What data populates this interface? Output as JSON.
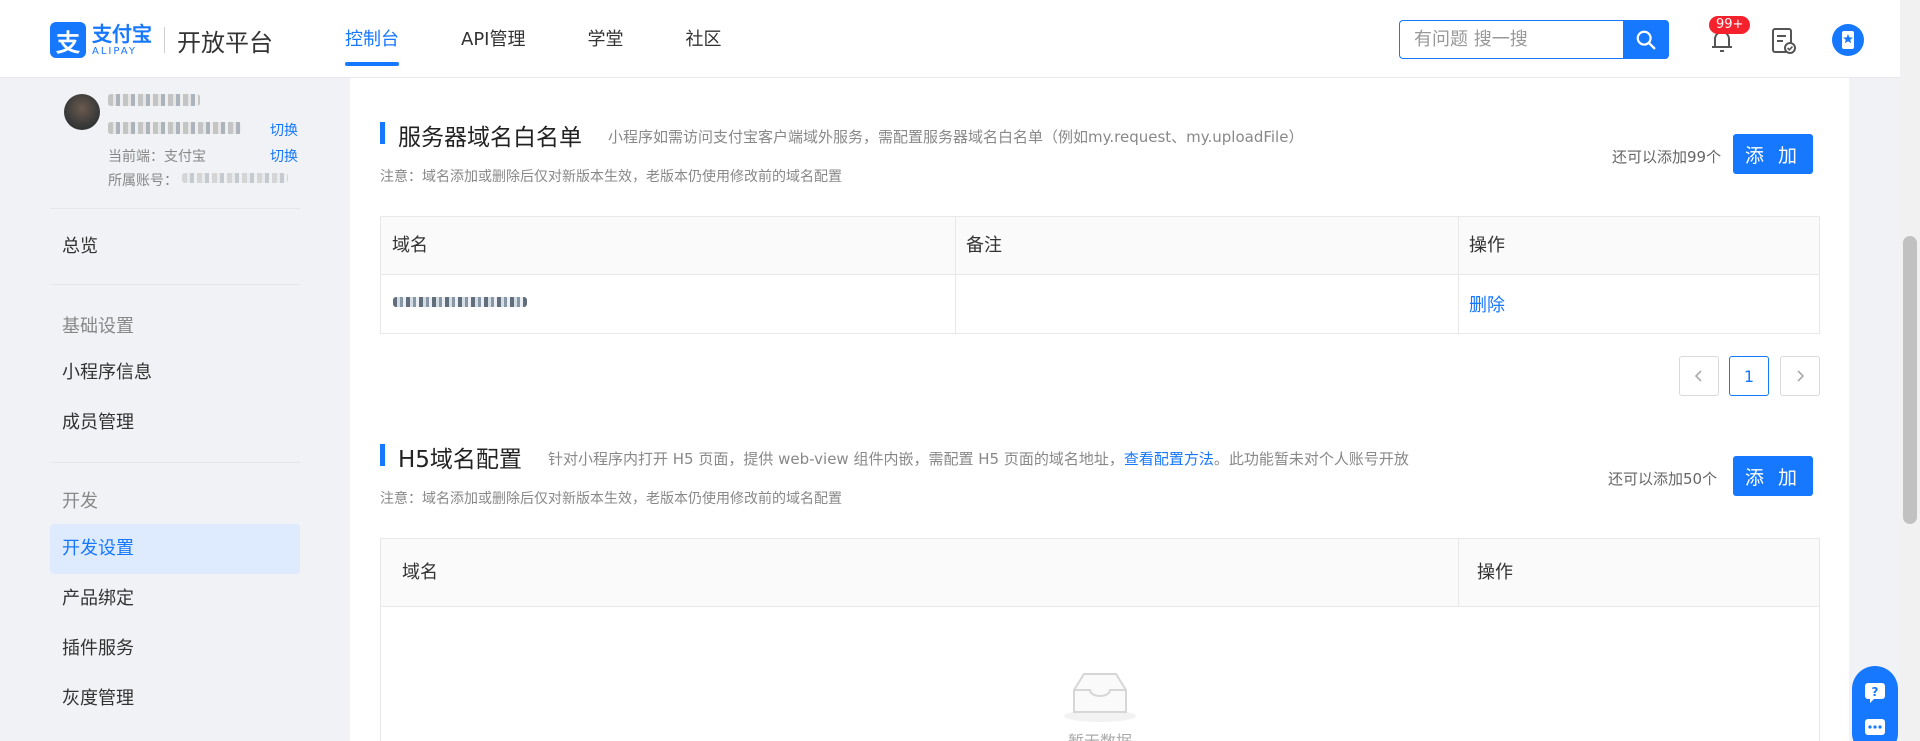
{
  "header": {
    "logo_cn": "支付宝",
    "logo_en": "ALIPAY",
    "platform": "开放平台",
    "nav": [
      "控制台",
      "API管理",
      "学堂",
      "社区"
    ],
    "search_placeholder": "有问题 搜一搜",
    "notification_badge": "99+"
  },
  "sidebar": {
    "switch_label": "切换",
    "current_client_label": "当前端：支付宝",
    "account_label": "所属账号：",
    "overview": "总览",
    "group_basic": "基础设置",
    "miniapp_info": "小程序信息",
    "member_mgmt": "成员管理",
    "group_dev": "开发",
    "dev_settings": "开发设置",
    "product_binding": "产品绑定",
    "plugin_service": "插件服务",
    "gray_mgmt": "灰度管理"
  },
  "server_domain": {
    "title": "服务器域名白名单",
    "desc": "小程序如需访问支付宝客户端域外服务，需配置服务器域名白名单（例如my.request、my.uploadFile）",
    "note": "注意：域名添加或删除后仅对新版本生效，老版本仍使用修改前的域名配置",
    "quota": "还可以添加99个",
    "add_label": "添 加",
    "columns": [
      "域名",
      "备注",
      "操作"
    ],
    "row_action": "删除",
    "page": "1"
  },
  "h5_domain": {
    "title": "H5域名配置",
    "desc_before": "针对小程序内打开 H5 页面，提供 web-view 组件内嵌，需配置 H5 页面的域名地址，",
    "desc_link": "查看配置方法",
    "desc_after": "。此功能暂未对个人账号开放",
    "note": "注意：域名添加或删除后仅对新版本生效，老版本仍使用修改前的域名配置",
    "quota": "还可以添加50个",
    "add_label": "添 加",
    "columns": [
      "域名",
      "操作"
    ],
    "empty_text": "暂无数据"
  },
  "colors": {
    "accent": "#1677ff",
    "badge": "#f5222d",
    "active_menu_bg": "#deebff"
  }
}
